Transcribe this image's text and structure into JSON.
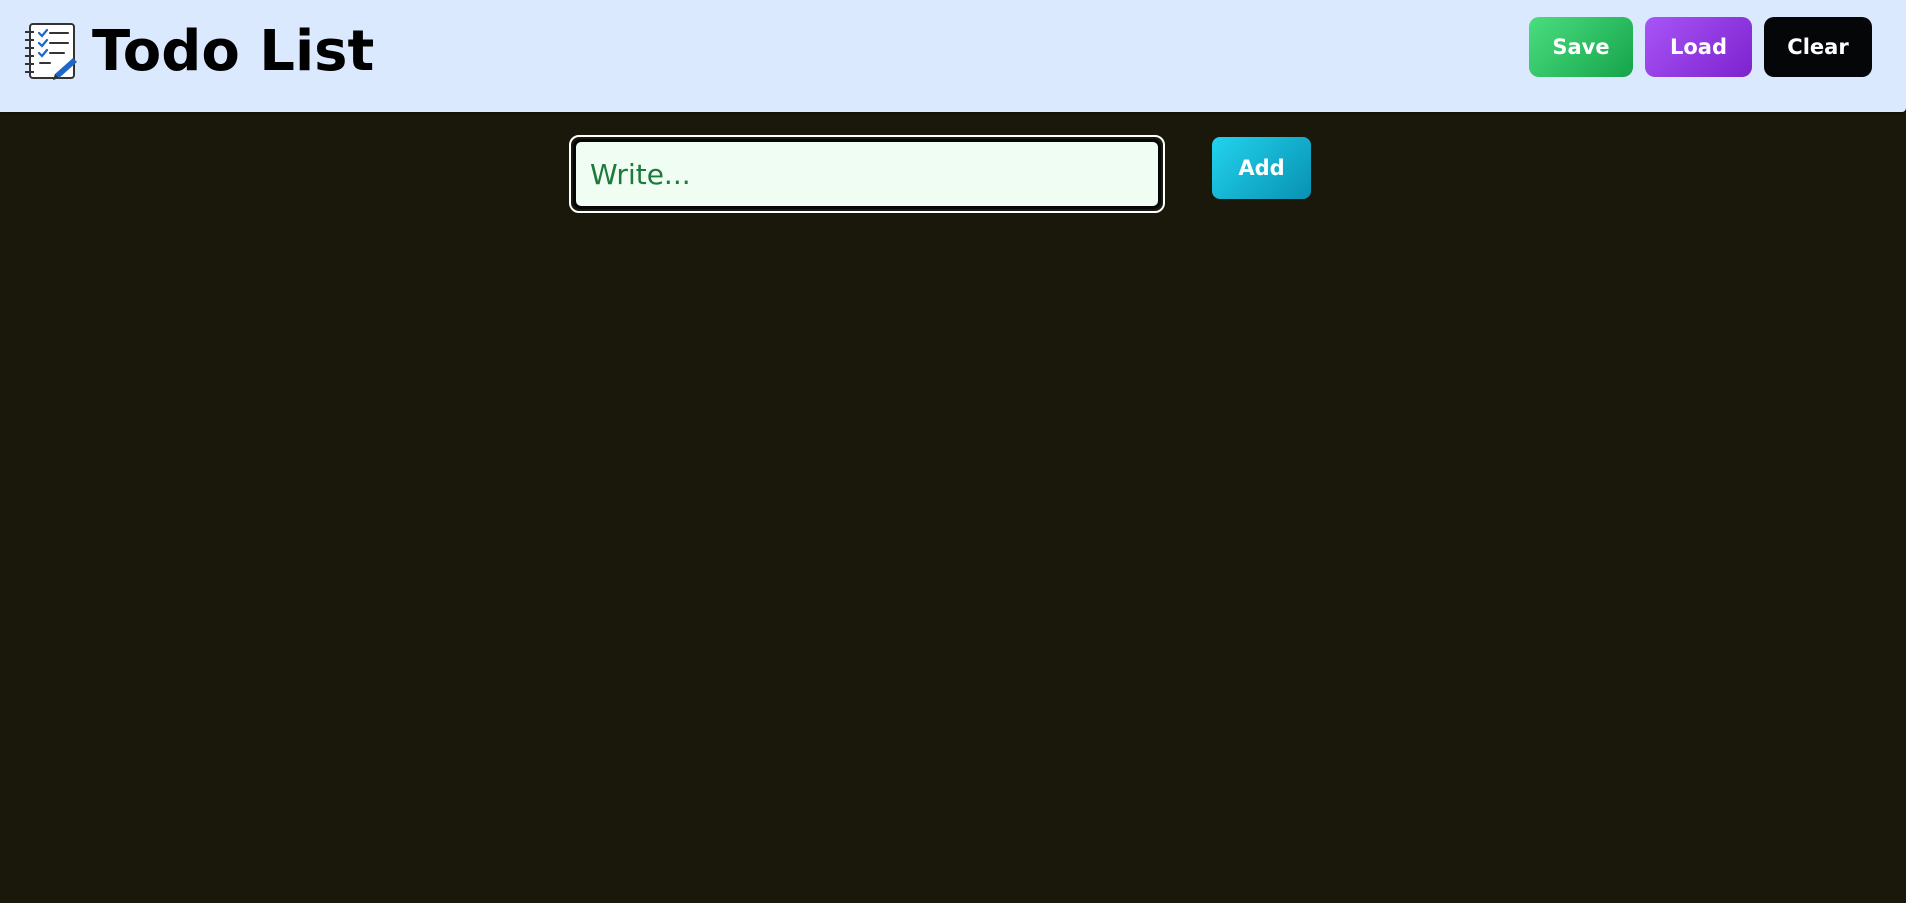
{
  "header": {
    "title": "Todo List",
    "icon": "notebook-checklist-icon",
    "background": "#dbe9fe"
  },
  "toolbar": {
    "save_label": "Save",
    "load_label": "Load",
    "clear_label": "Clear",
    "save_color": "#22c55e",
    "load_color": "#9333ea",
    "clear_color": "#050608"
  },
  "composer": {
    "placeholder": "Write...",
    "value": "",
    "add_label": "Add",
    "add_color": "#06b6d4"
  },
  "page": {
    "background": "#19180a"
  }
}
